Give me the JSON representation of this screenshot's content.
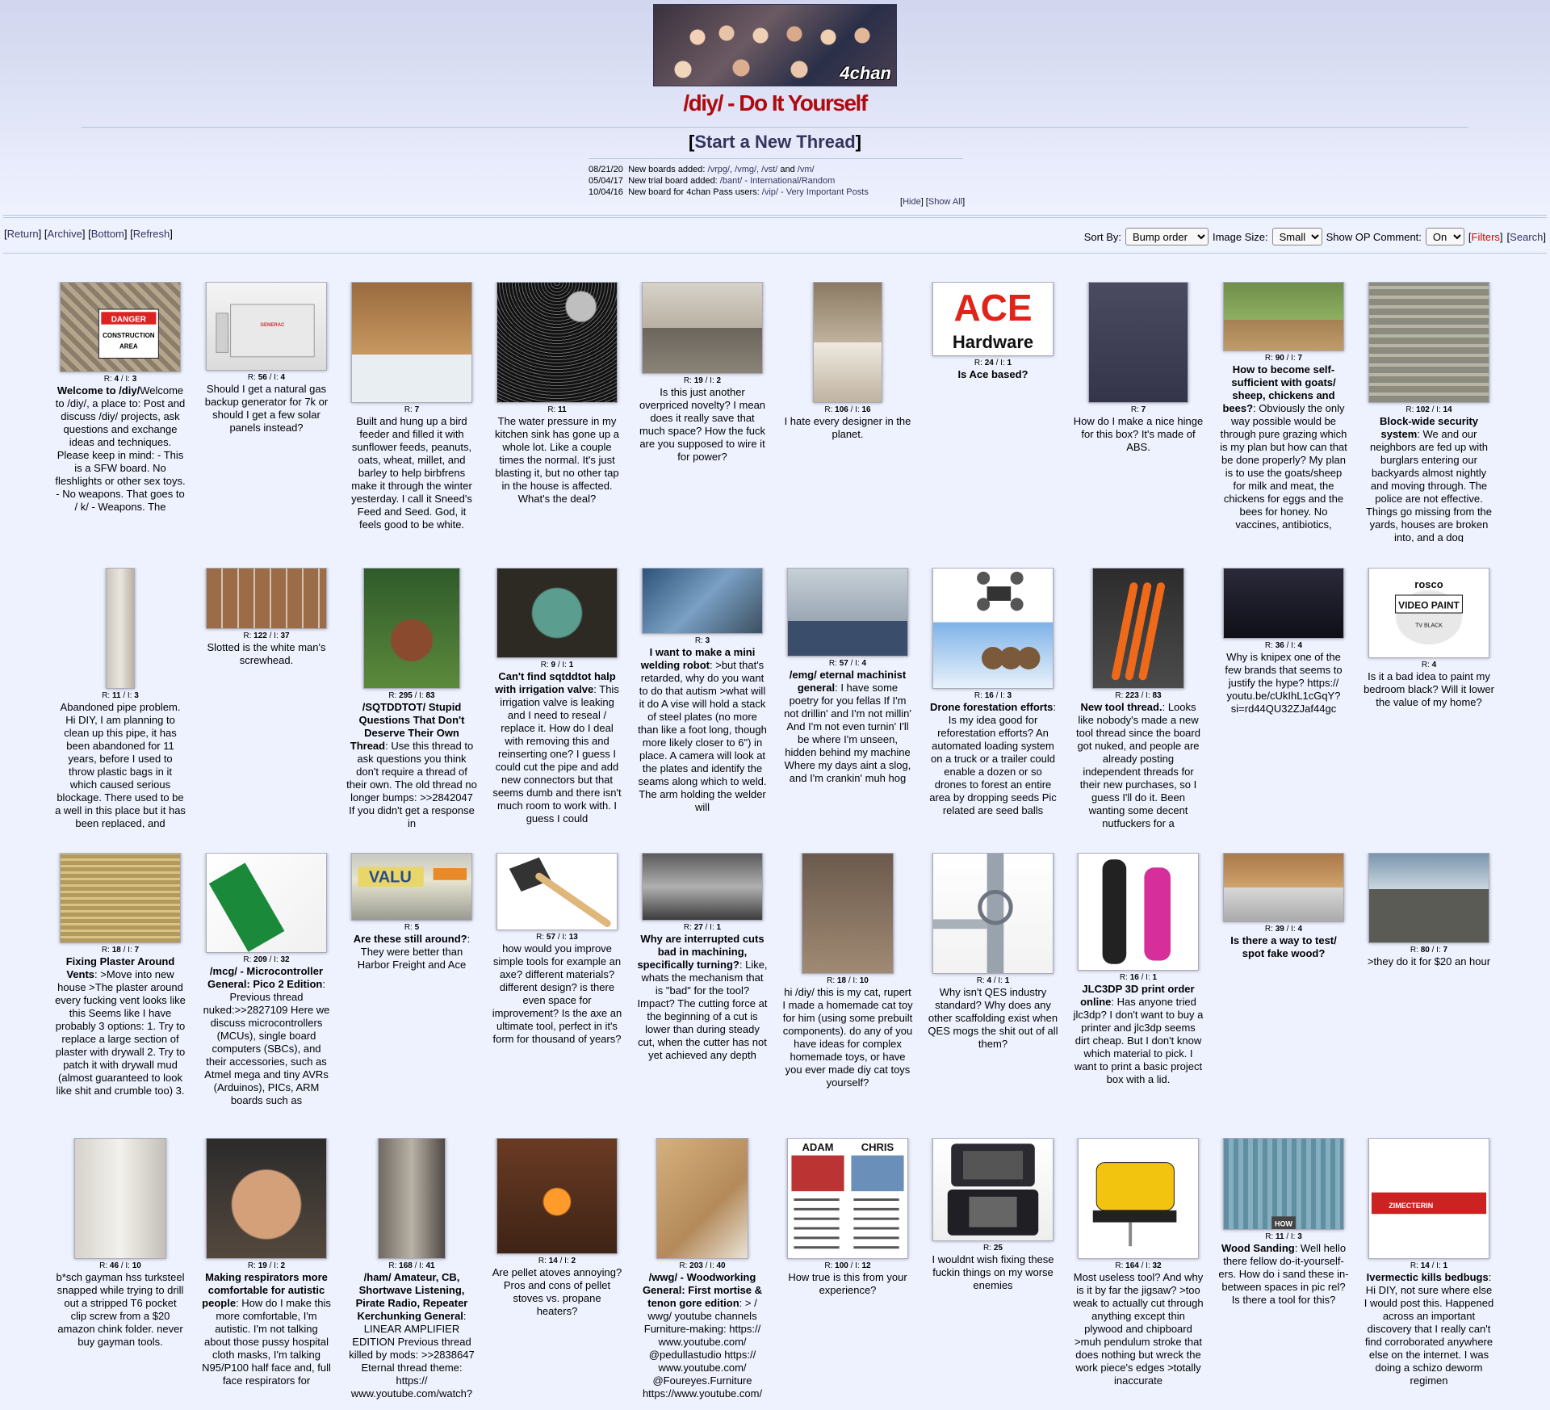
{
  "banner": {
    "logo_text": "4chan"
  },
  "board": {
    "title": "/diy/ - Do It Yourself"
  },
  "start_thread": {
    "open": "[",
    "label": "Start a New Thread",
    "close": "]"
  },
  "news": [
    {
      "date": "08/21/20",
      "text": "New boards added: ",
      "links": "/vrpg/, /vmg/, /vst/",
      "and": " and ",
      "last": "/vm/"
    },
    {
      "date": "05/04/17",
      "text": "New trial board added: ",
      "links": "/bant/ - International/Random"
    },
    {
      "date": "10/04/16",
      "text": "New board for 4chan Pass users: ",
      "links": "/vip/ - Very Important Posts"
    }
  ],
  "news_controls": {
    "hide": "Hide",
    "show_all": "Show All"
  },
  "nav": {
    "return": "Return",
    "archive": "Archive",
    "bottom": "Bottom",
    "refresh": "Refresh"
  },
  "controls": {
    "sort_label": "Sort By:",
    "sort_value": "Bump order",
    "image_size_label": "Image Size:",
    "image_size_value": "Small",
    "op_comment_label": "Show OP Comment:",
    "op_comment_value": "On",
    "filters": "Filters",
    "search": "Search"
  },
  "colors": {
    "board_title": "#af0a0f",
    "link": "#34345c",
    "background": "#eef2ff"
  },
  "threads": [
    {
      "r": "4",
      "i": "3",
      "subject": "Welcome to /diy/",
      "text": "Welcome to /diy/, a place to: Post and discuss /diy/ projects, ask questions and exchange ideas and techniques. Please keep in mind: - This is a SFW board. No fleshlights or other sex toys. - No weapons. That goes to / k/ - Weapons. The",
      "icon": "construction-sign",
      "sign": "DANGER CONSTRUCTION AREA"
    },
    {
      "r": "56",
      "i": "4",
      "subject": "",
      "text": "Should I get a natural gas backup generator for 7k or should I get a few solar panels instead?",
      "icon": "generator",
      "sign": "GENERAC"
    },
    {
      "r": "7",
      "i": "",
      "subject": "",
      "text": "Built and hung up a bird feeder and filled it with sunflower feeds, peanuts, oats, wheat, millet, and barley to help birbfrens make it through the winter yesterday. I call it Sneed's Feed and Seed. God, it feels good to be white.",
      "icon": "bird-feeder"
    },
    {
      "r": "11",
      "i": "",
      "subject": "",
      "text": "The water pressure in my kitchen sink has gone up a whole lot. Like a couple times the normal. It's just blasting it, but no other tap in the house is affected. What's the deal?",
      "icon": "shower-head"
    },
    {
      "r": "19",
      "i": "2",
      "subject": "",
      "text": "Is this just another overpriced novelty? I mean does it really save that much space? How the fuck are you supposed to wire it for power?",
      "icon": "kitchen-drawer"
    },
    {
      "r": "106",
      "i": "16",
      "subject": "",
      "text": "I hate every designer in the planet.",
      "icon": "sink"
    },
    {
      "r": "24",
      "i": "1",
      "subject": "Is Ace based?",
      "text": "",
      "icon": "ace-logo",
      "sign": "ACE",
      "sign2": "Hardware"
    },
    {
      "r": "7",
      "i": "",
      "subject": "",
      "text": "How do I make a nice hinge for this box? It's made of ABS.",
      "icon": "abs-box"
    },
    {
      "r": "90",
      "i": "7",
      "subject": "How to become self-sufficient with goats/ sheep, chickens and bees?",
      "text": ": Obviously the only way possible would be through pure grazing which is my plan but how can that be done properly? My plan is to use the goats/sheep for milk and meat, the chickens for eggs and the bees for honey. No vaccines, antibiotics,",
      "icon": "goat-chicken"
    },
    {
      "r": "102",
      "i": "14",
      "subject": "Block-wide security system",
      "text": ": We and our neighbors are fed up with burglars entering our backyards almost nightly and moving through. The police are not effective. Things go missing from the yards, houses are broken into, and a dog",
      "icon": "aerial-map"
    },
    {
      "r": "11",
      "i": "3",
      "subject": "",
      "text": "Abandoned pipe problem. Hi DIY, I am planning to clean up this pipe, it has been abandoned for 11 years, before I used to throw plastic bags in it which caused serious blockage. There used to be a well in this place but it has been replaced, and",
      "icon": "pipe"
    },
    {
      "r": "122",
      "i": "37",
      "subject": "",
      "text": "Slotted is the white man's screwhead.",
      "icon": "screw-heads"
    },
    {
      "r": "295",
      "i": "83",
      "subject": "/SQTDDTOT/ Stupid Questions That Don't Deserve Their Own Thread",
      "text": ": Use this thread to ask questions you think don't require a thread of their own. The old thread no longer bumps: >>2842047 If you didn't get a response in",
      "icon": "turkey"
    },
    {
      "r": "9",
      "i": "1",
      "subject": "Can't find sqtddtot halp with irrigation valve",
      "text": ": This irrigation valve is leaking and I need to reseal / replace it. How do I deal with removing this and reinserting one? I guess I could cut the pipe and add new connectors but that seems dumb and there isn't much room to work with. I guess I could",
      "icon": "irrigation-valve"
    },
    {
      "r": "3",
      "i": "",
      "subject": "I want to make a mini welding robot",
      "text": ": >but that's retarded, why do you want to do that autism >what will it do A vise will hold a stack of steel plates (no more than like a foot long, though more likely closer to 6\") in place. A camera will look at the plates and identify the seams along which to weld. The arm holding the welder will",
      "icon": "welding-robot"
    },
    {
      "r": "57",
      "i": "4",
      "subject": "/emg/ eternal machinist general",
      "text": ": I have some poetry for you fellas If I'm not drillin' and I'm not millin' And I'm not even turnin' I'll be where I'm unseen, hidden behind my machine Where my days aint a slog, and I'm crankin' muh hog",
      "icon": "machinist"
    },
    {
      "r": "16",
      "i": "3",
      "subject": "Drone forestation efforts",
      "text": ": Is my idea good for reforestation efforts? An automated loading system on a truck or a trailer could enable a dozen or so drones to forest an entire area by dropping seeds Pic related are seed balls",
      "icon": "drone"
    },
    {
      "r": "223",
      "i": "83",
      "subject": "New tool thread.",
      "text": ": Looks like nobody's made a new tool thread since the board got nuked, and people are already posting independent threads for their new purchases, so I guess I'll do it. Been wanting some decent nutfuckers for a",
      "icon": "wrenches"
    },
    {
      "r": "36",
      "i": "4",
      "subject": "",
      "text": "Why is knipex one of the few brands that seems to justify the hype? https:// youtu.be/cUkIhL1cGqY? si=rd44QU32ZJaf44gc",
      "icon": "knipex-pliers"
    },
    {
      "r": "4",
      "i": "",
      "subject": "",
      "text": "Is it a bad idea to paint my bedroom black? Will it lower the value of my home?",
      "icon": "paint-can",
      "sign": "rosco",
      "sign2": "VIDEO PAINT",
      "sign3": "TV BLACK"
    },
    {
      "r": "18",
      "i": "7",
      "subject": "Fixing Plaster Around Vents",
      "text": ": >Move into new house >The plaster around every fucking vent looks like this Seems like I have probably 3 options: 1. Try to replace a large section of plaster with drywall 2. Try to patch it with drywall mud (almost guaranteed to look like shit and crumble too) 3.",
      "icon": "plaster-vent"
    },
    {
      "r": "209",
      "i": "32",
      "subject": "/mcg/ - Microcontroller General: Pico 2 Edition",
      "text": ": Previous thread nuked:>>2827109 Here we discuss microcontrollers (MCUs), single board computers (SBCs), and their accessories, such as Atmel mega and tiny AVRs (Arduinos), PICs, ARM boards such as",
      "icon": "pico-board"
    },
    {
      "r": "5",
      "i": "",
      "subject": "Are these still around?",
      "text": ": They were better than Harbor Freight and Ace",
      "icon": "valu-store",
      "sign": "VALU"
    },
    {
      "r": "57",
      "i": "13",
      "subject": "",
      "text": "how would you improve simple tools for example an axe? different materials? different design? is there even space for improvement? Is the axe an ultimate tool, perfect in it's form for thousand of years?",
      "icon": "axe"
    },
    {
      "r": "27",
      "i": "1",
      "subject": "Why are interrupted cuts bad in machining, specifically turning?",
      "text": ": Like, whats the mechanism that is \"bad\" for the tool? Impact? The cutting force at the beginning of a cut is lower than during steady cut, when the cutter has not yet achieved any depth",
      "icon": "lathe"
    },
    {
      "r": "18",
      "i": "10",
      "subject": "",
      "text": "hi /diy/ this is my cat, rupert I made a homemade cat toy for him (using some prebuilt components). do any of you have ideas for complex homemade toys, or have you ever made diy cat toys yourself?",
      "icon": "cat-toy"
    },
    {
      "r": "4",
      "i": "1",
      "subject": "",
      "text": "Why isn't QES industry standard? Why does any other scaffolding exist when QES mogs the shit out of all them?",
      "icon": "scaffolding"
    },
    {
      "r": "16",
      "i": "1",
      "subject": "JLC3DP 3D print order online",
      "text": ": Has anyone tried jlc3dp? I don't want to buy a printer and jlc3dp seems dirt cheap. But I don't know which material to pick. I want to print a basic project box with a lid.",
      "icon": "3d-print"
    },
    {
      "r": "39",
      "i": "4",
      "subject": "Is there a way to test/ spot fake wood?",
      "text": "",
      "icon": "wood-board"
    },
    {
      "r": "80",
      "i": "7",
      "subject": "",
      "text": ">they do it for $20 an hour",
      "icon": "oil-rig"
    },
    {
      "r": "46",
      "i": "10",
      "subject": "",
      "text": "b*sch gayman hss turksteel snapped while trying to drill out a stripped T6 pocket clip screw from a $20 amazon chink folder. never buy gayman tools.",
      "icon": "screwdriver-bit"
    },
    {
      "r": "19",
      "i": "2",
      "subject": "Making respirators more comfortable for autistic people",
      "text": ": How do I make this more comfortable, I'm autistic. I'm not talking about those pussy hospital cloth masks, I'm talking N95/P100 half face and, full face respirators for",
      "icon": "smiling-man"
    },
    {
      "r": "168",
      "i": "41",
      "subject": "/ham/ Amateur, CB, Shortwave Listening, Pirate Radio, Repeater Kerchunking General",
      "text": ": LINEAR AMPLIFIER EDITION Previous thread killed by mods: >>2838647 Eternal thread theme: https:// www.youtube.com/watch?",
      "icon": "amplifier-tube"
    },
    {
      "r": "14",
      "i": "2",
      "subject": "",
      "text": "Are pellet atoves annoying? Pros and cons of pellet stoves vs. propane heaters?",
      "icon": "pellet-stove"
    },
    {
      "r": "203",
      "i": "40",
      "subject": "/wwg/ - Woodworking General: First mortise & tenon gore edition",
      "text": ": > / wwg/ youtube channels Furniture-making: https:// www.youtube.com/ @pedullastudio https:// www.youtube.com/ @Foureyes.Furniture https://www.youtube.com/",
      "icon": "mortise"
    },
    {
      "r": "100",
      "i": "12",
      "subject": "",
      "text": "How true is this from your experience?",
      "icon": "adam-chris",
      "sign": "ADAM",
      "sign2": "CHRIS"
    },
    {
      "r": "25",
      "i": "",
      "subject": "",
      "text": "I wouldnt wish fixing these fuckin things on my worse enemies",
      "icon": "nintendo-ds"
    },
    {
      "r": "164",
      "i": "32",
      "subject": "",
      "text": "Most useless tool? And why is it by far the jigsaw? >too weak to actually cut through anything except thin plywood and chipboard >muh pendulum stroke that does nothing but wreck the work piece's edges >totally inaccurate",
      "icon": "jigsaw"
    },
    {
      "r": "11",
      "i": "3",
      "subject": "Wood Sanding",
      "text": ": Well hello there fellow do-it-yourself-ers. How do i sand these in-between spaces in pic rel? Is there a tool for this?",
      "icon": "wood-siding",
      "sign": "HOW"
    },
    {
      "r": "14",
      "i": "1",
      "subject": "Ivermectic kills bedbugs",
      "text": ": Hi DIY, not sure where else I would post this. Happened across an important discovery that I really can't find corroborated anywhere else on the internet. I was doing a schizo deworm regimen",
      "icon": "zimecterin",
      "sign": "ZIMECTERIN"
    }
  ]
}
